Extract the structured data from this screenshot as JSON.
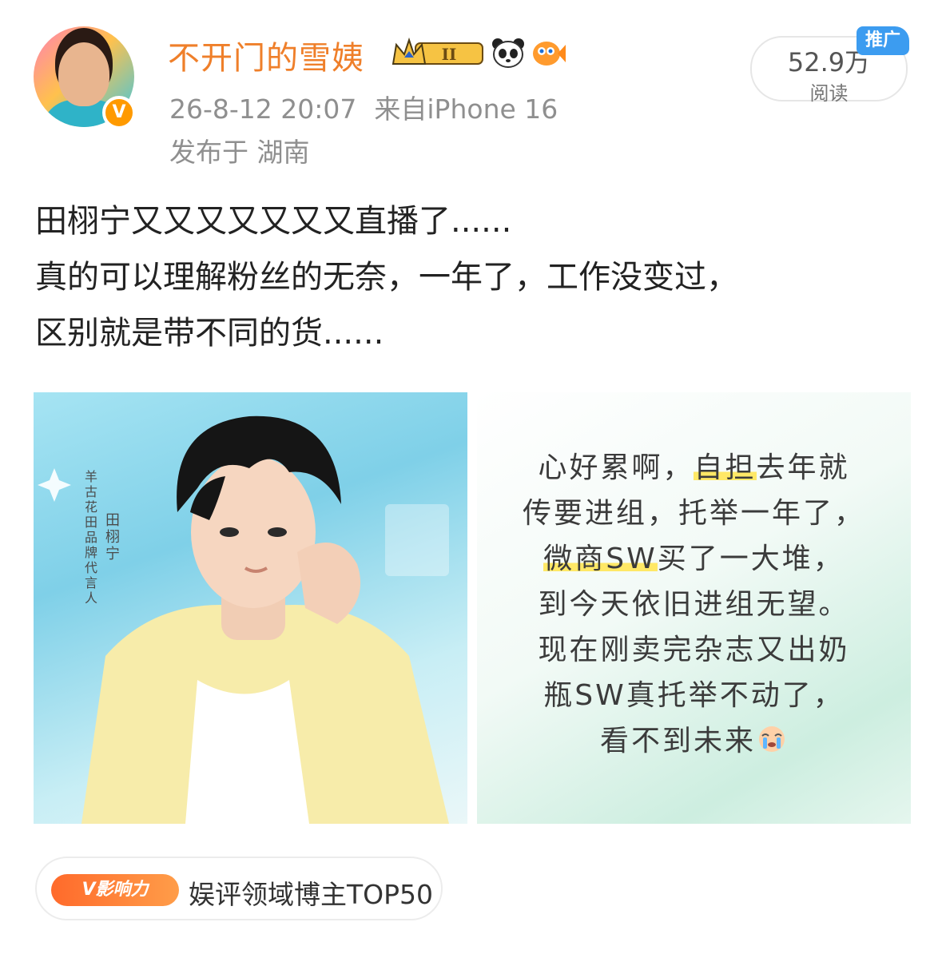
{
  "author": {
    "name": "不开门的雪姨",
    "verified_badge": "V",
    "timestamp": "26-8-12 20:07",
    "source": "来自iPhone 16",
    "location": "发布于 湖南"
  },
  "stats": {
    "reads": "52.9万",
    "reads_label": "阅读",
    "promo_badge": "推广"
  },
  "post": {
    "lines": [
      "田栩宁又又又又又又又直播了......",
      "真的可以理解粉丝的无奈，一年了，工作没变过，",
      "区别就是带不同的货......"
    ]
  },
  "images": {
    "left": {
      "caption": "羊古花田品牌代言人",
      "name_vertical": "田栩宁"
    },
    "right": {
      "lines": [
        "心好累啊，自担去年就",
        "传要进组，托举一年了，",
        "微商SW买了一大堆，",
        "到今天依旧进组无望。",
        "现在刚卖完杂志又出奶",
        "瓶SW真托举不动了，",
        "看不到未来"
      ],
      "emoji": "crying-face-icon"
    }
  },
  "influence": {
    "badge": "V影响力",
    "text": "娱评领域博主TOP50"
  },
  "colors": {
    "name": "#ef7f2a",
    "meta": "#8f8f8f",
    "promo": "#3c9cf0",
    "influence_badge": "#ff7a35"
  }
}
